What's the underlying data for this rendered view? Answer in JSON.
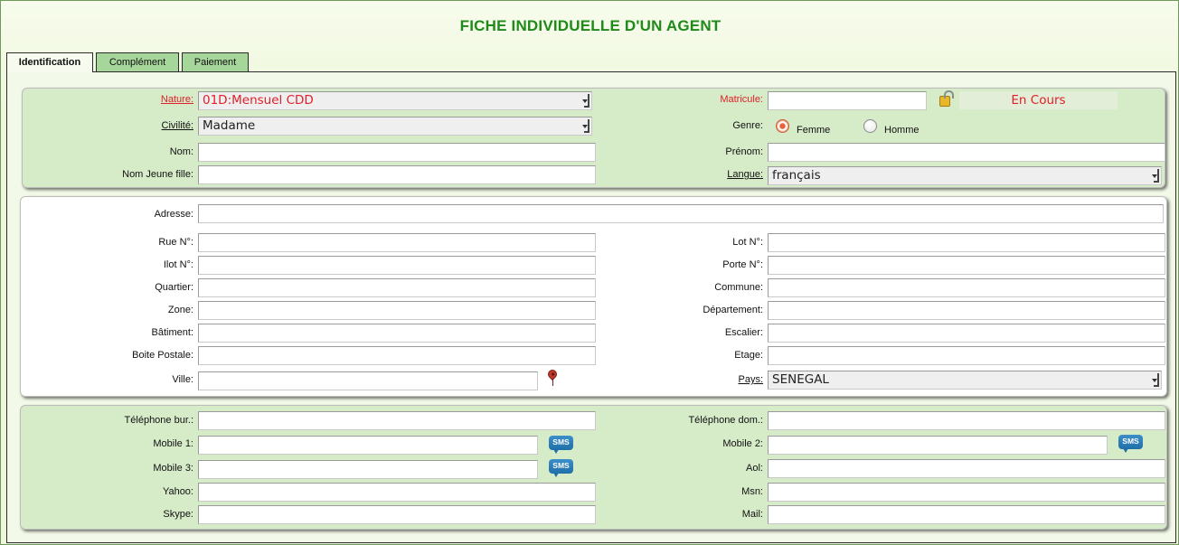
{
  "title": "FICHE INDIVIDUELLE D'UN AGENT",
  "tabs": [
    "Identification",
    "Complément",
    "Paiement"
  ],
  "identity": {
    "nature_label": "Nature:",
    "nature_value": "01D:Mensuel CDD",
    "civilite_label": "Civilité:",
    "civilite_value": "Madame",
    "nom_label": "Nom:",
    "nom_jeune_fille_label": "Nom Jeune fille:",
    "matricule_label": "Matricule:",
    "status_value": "En Cours",
    "genre_label": "Genre:",
    "genre_options": [
      "Femme",
      "Homme"
    ],
    "genre_selected": "Femme",
    "prenom_label": "Prénom:",
    "langue_label": "Langue:",
    "langue_value": "français"
  },
  "address": {
    "adresse_label": "Adresse:",
    "rue_label": "Rue N°:",
    "ilot_label": "Ilot N°:",
    "quartier_label": "Quartier:",
    "zone_label": "Zone:",
    "batiment_label": "Bâtiment:",
    "boite_postale_label": "Boite Postale:",
    "ville_label": "Ville:",
    "lot_label": "Lot N°:",
    "porte_label": "Porte N°:",
    "commune_label": "Commune:",
    "departement_label": "Département:",
    "escalier_label": "Escalier:",
    "etage_label": "Etage:",
    "pays_label": "Pays:",
    "pays_value": "SENEGAL"
  },
  "contact": {
    "tel_bur_label": "Téléphone bur.:",
    "mobile1_label": "Mobile 1:",
    "mobile3_label": "Mobile 3:",
    "yahoo_label": "Yahoo:",
    "skype_label": "Skype:",
    "tel_dom_label": "Téléphone dom.:",
    "mobile2_label": "Mobile 2:",
    "aol_label": "Aol:",
    "msn_label": "Msn:",
    "mail_label": "Mail:",
    "sms_label": "SMS"
  },
  "icons": {
    "lock": "unlock-icon",
    "map_pin": "map-pin-icon",
    "sms": "sms-icon"
  },
  "colors": {
    "title": "#1f8a1a",
    "required_label": "#e0202a",
    "panel_green": "#d6ebc8",
    "tab_inactive": "#a7d69a"
  }
}
